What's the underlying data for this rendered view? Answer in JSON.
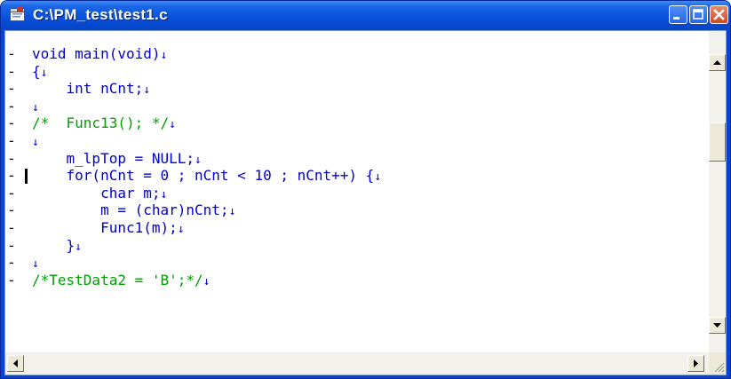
{
  "window": {
    "title": "C:\\PM_test\\test1.c"
  },
  "editor": {
    "lines": [
      {
        "marker": "-",
        "text": "void main(void)",
        "kind": "code"
      },
      {
        "marker": "-",
        "text": "{",
        "kind": "code"
      },
      {
        "marker": "-",
        "text": "    int nCnt;",
        "kind": "code"
      },
      {
        "marker": "-",
        "text": "",
        "kind": "code"
      },
      {
        "marker": "-",
        "text": "/*  Func13(); */",
        "kind": "comment"
      },
      {
        "marker": "-",
        "text": "",
        "kind": "code"
      },
      {
        "marker": "-",
        "text": "    m_lpTop = NULL;",
        "kind": "code"
      },
      {
        "marker": "-",
        "text": "    for(nCnt = 0 ; nCnt < 10 ; nCnt++) {",
        "kind": "code"
      },
      {
        "marker": "-",
        "text": "        char m;",
        "kind": "code"
      },
      {
        "marker": "-",
        "text": "        m = (char)nCnt;",
        "kind": "code"
      },
      {
        "marker": "-",
        "text": "        Func1(m);",
        "kind": "code"
      },
      {
        "marker": "-",
        "text": "    }",
        "kind": "code"
      },
      {
        "marker": "-",
        "text": "",
        "kind": "code"
      },
      {
        "marker": "-",
        "text": "/*TestData2 = 'B';*/",
        "kind": "comment"
      }
    ],
    "newline_glyph": "↓",
    "caret_line": 8
  },
  "icons": {
    "app": "editor-document-icon",
    "minimize": "minimize-icon",
    "maximize": "maximize-icon",
    "close": "close-icon"
  },
  "colors": {
    "titlebar": "#0a55dd",
    "code_text": "#0000cc",
    "comment_text": "#00a000"
  }
}
